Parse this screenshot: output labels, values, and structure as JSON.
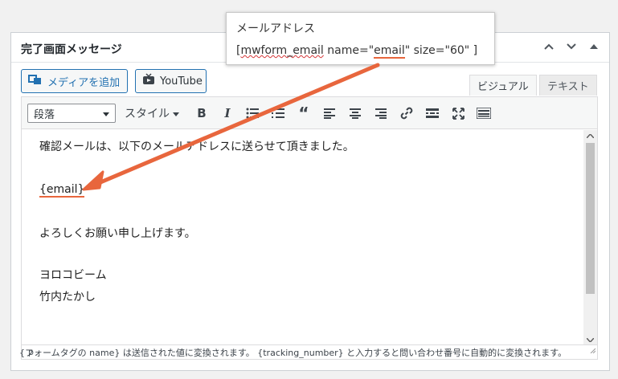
{
  "panel": {
    "title": "完了画面メッセージ"
  },
  "media": {
    "add_media": "メディアを追加",
    "youtube": "YouTube"
  },
  "tabs": {
    "visual": "ビジュアル",
    "text": "テキスト"
  },
  "toolbar": {
    "format": "段落",
    "style": "スタイル"
  },
  "content": {
    "line1": "確認メールは、以下のメールアドレスに送らせて頂きました。",
    "line2": "{email}",
    "line3": "よろしくお願い申し上げます。",
    "line4": "ヨロコビーム",
    "line5": "竹内たかし"
  },
  "status": {
    "path": "p"
  },
  "note": {
    "text": "{フォームタグの name} は送信された値に変換されます。 {tracking_number} と入力すると問い合わせ番号に自動的に変換されます。"
  },
  "callout": {
    "label": "メールアドレス",
    "open": "[",
    "tag": "mwform_email",
    "mid": " name=\"",
    "name": "email",
    "rest": "\" size=\"60\" ]"
  },
  "colors": {
    "accent": "#2271b1",
    "annotation": "#e8663d"
  }
}
